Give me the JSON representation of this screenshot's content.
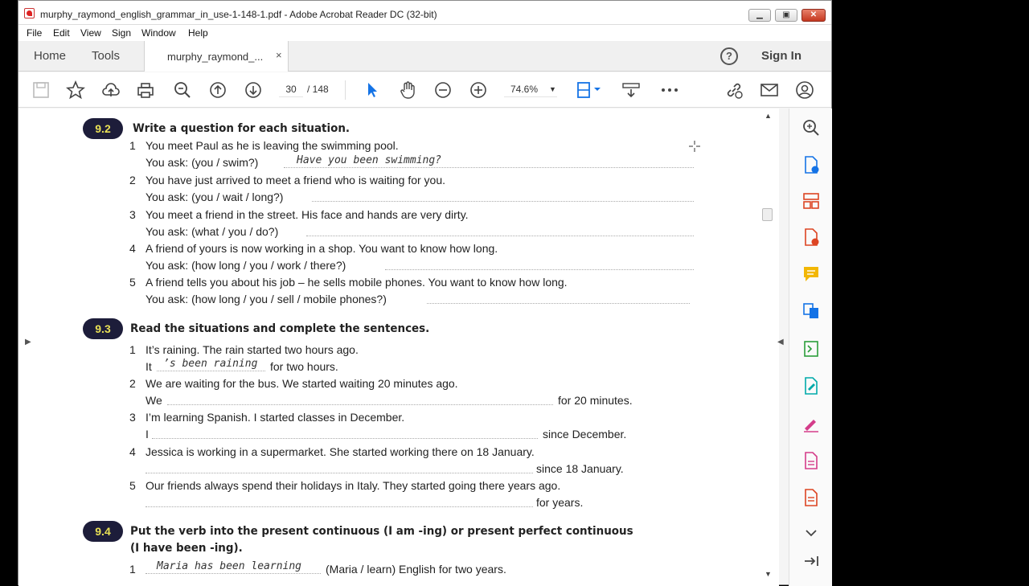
{
  "window": {
    "title": "murphy_raymond_english_grammar_in_use-1-148-1.pdf - Adobe Acrobat Reader DC (32-bit)"
  },
  "menu": [
    "File",
    "Edit",
    "View",
    "Sign",
    "Window",
    "Help"
  ],
  "tabs": {
    "home": "Home",
    "tools": "Tools",
    "doc": "murphy_raymond_...",
    "close": "×"
  },
  "header": {
    "help": "?",
    "sign_in": "Sign In"
  },
  "toolbar": {
    "page_current": "30",
    "page_total": "/ 148",
    "zoom": "74.6%",
    "zoom_caret": "▼"
  },
  "page": {
    "ex92": {
      "badge": "9.2",
      "heading": "Write a question for each situation.",
      "items": [
        {
          "n": "1",
          "line1": "You meet Paul as he is leaving the swimming pool.",
          "line2": "You ask: (you / swim?)",
          "answer": "Have you been swimming?"
        },
        {
          "n": "2",
          "line1": "You have just arrived to meet a friend who is waiting for you.",
          "line2": "You ask: (you / wait / long?)"
        },
        {
          "n": "3",
          "line1": "You meet a friend in the street.  His face and hands are very dirty.",
          "line2": "You ask: (what / you / do?)"
        },
        {
          "n": "4",
          "line1": "A friend of yours is now working in a shop.  You want to know how long.",
          "line2": "You ask: (how long / you / work / there?)"
        },
        {
          "n": "5",
          "line1": "A friend tells you about his job – he sells mobile phones.  You want to know how long.",
          "line2": "You ask: (how long / you / sell / mobile phones?)"
        }
      ]
    },
    "ex93": {
      "badge": "9.3",
      "heading": "Read the situations and complete the sentences.",
      "items": [
        {
          "n": "1",
          "line1": "It’s raining.  The rain started two hours ago.",
          "start": "It",
          "answer": "’s been raining",
          "end": "for two hours."
        },
        {
          "n": "2",
          "line1": "We are waiting for the bus.  We started waiting 20 minutes ago.",
          "start": "We",
          "end": "for 20 minutes."
        },
        {
          "n": "3",
          "line1": "I’m learning Spanish.  I started classes in December.",
          "start": "I",
          "end": "since December."
        },
        {
          "n": "4",
          "line1": "Jessica is working in a supermarket.  She started working there on 18 January.",
          "end": "since 18 January."
        },
        {
          "n": "5",
          "line1": "Our friends always spend their holidays in Italy.  They started going there years ago.",
          "end": "for years."
        }
      ]
    },
    "ex94": {
      "badge": "9.4",
      "heading_a": "Put the verb into the present continuous ",
      "heading_b": "(I am -ing)",
      "heading_c": " or present perfect continuous",
      "heading_d": "(I have been -ing).",
      "item1": {
        "n": "1",
        "answer": "Maria has been learning",
        "rest": "(Maria / learn) English for two years."
      }
    }
  }
}
